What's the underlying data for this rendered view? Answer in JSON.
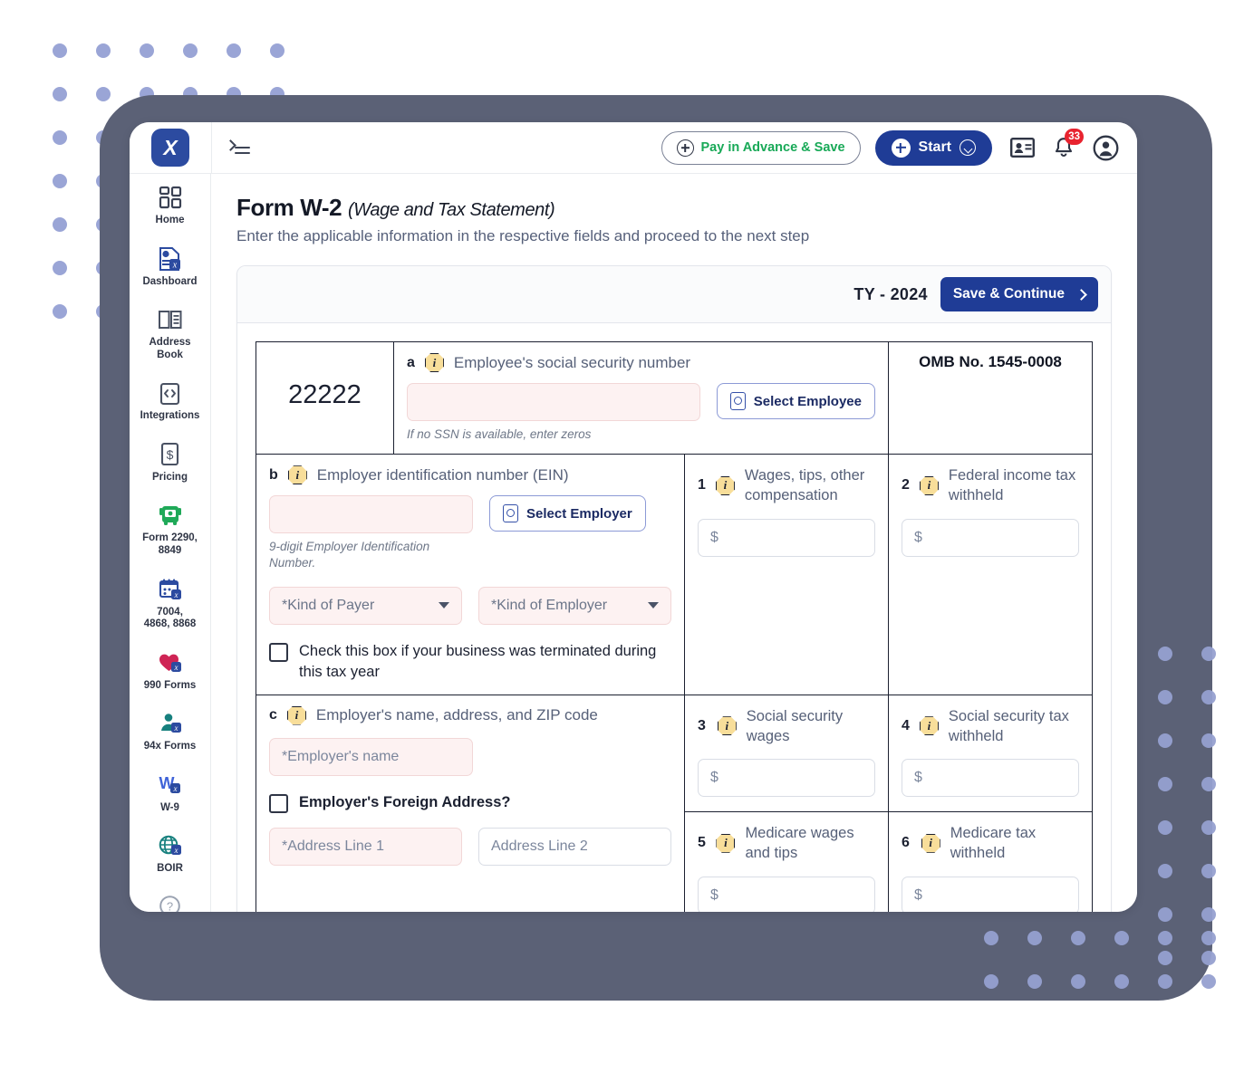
{
  "topbar": {
    "logo_text": "X",
    "menu_icon": "collapse-menu-icon",
    "pay_in_advance_label": "Pay in Advance & Save",
    "start_label": "Start",
    "notifications_count": "33",
    "accent_blue": "#1F3C96",
    "accent_green": "#18A957",
    "badge_red": "#E8232F"
  },
  "sidebar": {
    "items": [
      {
        "label": "Home",
        "icon": "grid-dashboard-icon"
      },
      {
        "label": "Dashboard",
        "icon": "document-chart-icon"
      },
      {
        "label": "Address\nBook",
        "label_line1": "Address",
        "label_line2": "Book",
        "icon": "address-book-icon"
      },
      {
        "label": "Integrations",
        "icon": "code-clipboard-icon"
      },
      {
        "label": "Pricing",
        "icon": "dollar-document-icon"
      },
      {
        "label": "Form 2290,\n8849",
        "label_line1": "Form 2290,",
        "label_line2": "8849",
        "icon": "truck-icon"
      },
      {
        "label": "7004,\n4868, 8868",
        "label_line1": "7004,",
        "label_line2": "4868, 8868",
        "icon": "calendar-icon"
      },
      {
        "label": "990 Forms",
        "icon": "heart-icon"
      },
      {
        "label": "94x Forms",
        "icon": "person-tie-icon"
      },
      {
        "label": "W-9",
        "icon": "w-letter-icon"
      },
      {
        "label": "BOIR",
        "icon": "globe-icon"
      }
    ],
    "help_icon": "help-question-icon"
  },
  "page": {
    "title": "Form W-2",
    "title_sub": "(Wage and Tax Statement)",
    "description": "Enter the applicable information in the respective fields and proceed to the next step"
  },
  "card": {
    "tax_year": "TY - 2024",
    "save_continue_label": "Save & Continue"
  },
  "form": {
    "form_number": "22222",
    "omb": "OMB No. 1545-0008",
    "box_a": {
      "letter": "a",
      "label": "Employee's social security number",
      "input_value": "",
      "input_placeholder": "",
      "hint": "If no SSN is available, enter zeros",
      "select_button": "Select Employee"
    },
    "box_b": {
      "letter": "b",
      "label": "Employer identification number (EIN)",
      "input_value": "",
      "input_placeholder": "",
      "hint": "9-digit Employer Identification Number.",
      "select_button": "Select Employer",
      "kind_of_payer": "*Kind of Payer",
      "kind_of_employer": "*Kind of Employer",
      "terminated_checkbox": "Check this box if your business was terminated during this tax year"
    },
    "box_c": {
      "letter": "c",
      "label": "Employer's name, address, and ZIP code",
      "employer_name_placeholder": "*Employer's name",
      "foreign_address_checkbox": "Employer's Foreign Address?",
      "address_line1_placeholder": "*Address Line 1",
      "address_line2_placeholder": "Address Line 2"
    },
    "numbered_boxes": [
      {
        "number": "1",
        "label": "Wages, tips, other compensation",
        "value": "",
        "prefix": "$"
      },
      {
        "number": "2",
        "label": "Federal income tax withheld",
        "value": "",
        "prefix": "$"
      },
      {
        "number": "3",
        "label": "Social security wages",
        "value": "",
        "prefix": "$"
      },
      {
        "number": "4",
        "label": "Social security tax withheld",
        "value": "",
        "prefix": "$"
      },
      {
        "number": "5",
        "label": "Medicare wages and tips",
        "value": "",
        "prefix": "$"
      },
      {
        "number": "6",
        "label": "Medicare tax withheld",
        "value": "",
        "prefix": "$"
      }
    ],
    "info_icon": "info-icon"
  },
  "decor": {
    "dot_color": "#9AA5D6",
    "frame_color": "#5B6176"
  }
}
